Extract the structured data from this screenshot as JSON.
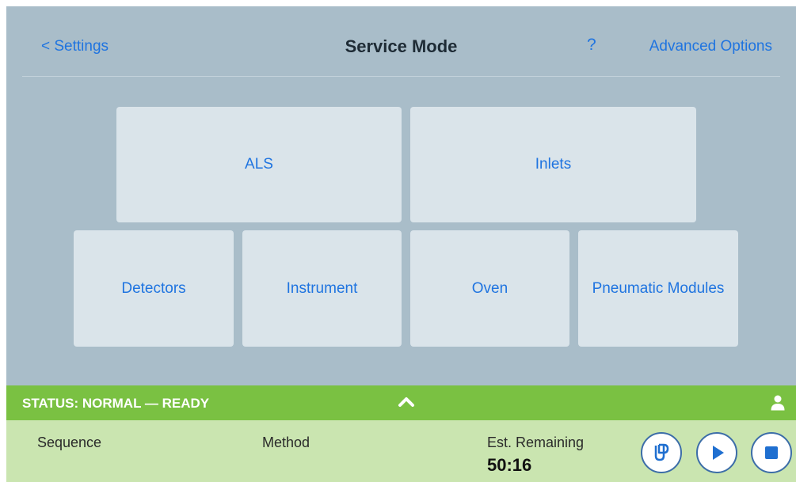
{
  "header": {
    "back_label": "< Settings",
    "title": "Service Mode",
    "help_label": "?",
    "advanced_label": "Advanced Options"
  },
  "tiles": {
    "als": "ALS",
    "inlets": "Inlets",
    "detectors": "Detectors",
    "instrument": "Instrument",
    "oven": "Oven",
    "pneumatic": "Pneumatic Modules"
  },
  "status": {
    "text": "STATUS: NORMAL — READY",
    "color": "#7ac142"
  },
  "footer": {
    "sequence_label": "Sequence",
    "method_label": "Method",
    "remaining_label": "Est. Remaining",
    "remaining_value": "50:16"
  },
  "icons": {
    "status_toggle": "chevron-up-icon",
    "user": "user-icon",
    "prep": "prep-run-icon",
    "start": "play-icon",
    "stop": "stop-icon"
  },
  "colors": {
    "background": "#a9bdc9",
    "tile": "#dae4ea",
    "link": "#1f74e0",
    "footer": "#cae5b0",
    "button_accent": "#1f6fd0"
  }
}
